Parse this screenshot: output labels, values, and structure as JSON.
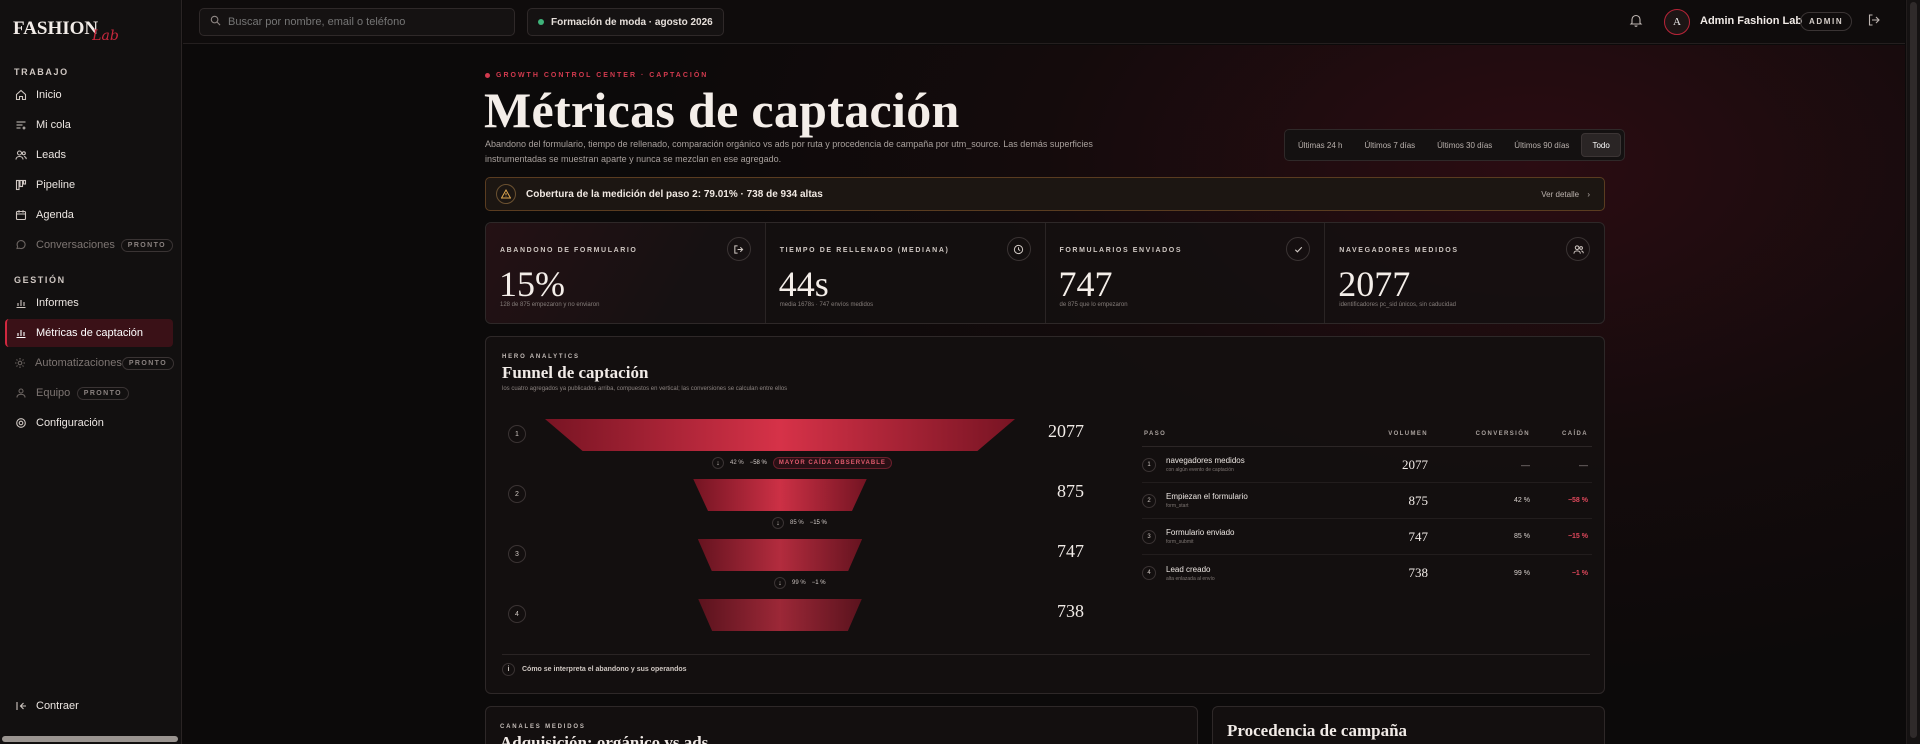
{
  "brand": {
    "logo_text": "FASHION",
    "logo_script": "Lab"
  },
  "sidebar": {
    "section_work": "TRABAJO",
    "section_manage": "GESTIÓN",
    "items": [
      {
        "label": "Inicio",
        "icon": "home-icon"
      },
      {
        "label": "Mi cola",
        "icon": "queue-icon"
      },
      {
        "label": "Leads",
        "icon": "users-icon"
      },
      {
        "label": "Pipeline",
        "icon": "pipeline-icon"
      },
      {
        "label": "Agenda",
        "icon": "calendar-icon"
      },
      {
        "label": "Conversaciones",
        "icon": "chat-icon",
        "badge": "PRONTO"
      },
      {
        "label": "Informes",
        "icon": "bar-chart-icon"
      },
      {
        "label": "Métricas de captación",
        "icon": "bar-chart-icon"
      },
      {
        "label": "Automatizaciones",
        "icon": "gear-icon",
        "badge": "PRONTO"
      },
      {
        "label": "Equipo",
        "icon": "team-icon",
        "badge": "PRONTO"
      },
      {
        "label": "Configuración",
        "icon": "settings-icon"
      }
    ],
    "collapse_label": "Contraer"
  },
  "topbar": {
    "search_placeholder": "Buscar por nombre, email o teléfono",
    "cohort": "Formación de moda · agosto 2026",
    "avatar_initial": "A",
    "user_name": "Admin Fashion Lab",
    "role_badge": "ADMIN"
  },
  "header": {
    "eyebrow": "GROWTH CONTROL CENTER · CAPTACIÓN",
    "title": "Métricas de captación",
    "description": "Abandono del formulario, tiempo de rellenado, comparación orgánico vs ads por ruta y procedencia de campaña por utm_source. Las demás superficies instrumentadas se muestran aparte y nunca se mezclan en ese agregado."
  },
  "ranges": [
    "Últimas 24 h",
    "Últimos 7 días",
    "Últimos 30 días",
    "Últimos 90 días",
    "Todo"
  ],
  "active_range": "Todo",
  "alert": {
    "message": "Cobertura de la medición del paso 2: 79.01% · 738 de 934 altas",
    "link": "Ver detalle"
  },
  "kpis": [
    {
      "label": "ABANDONO DE FORMULARIO",
      "value": "15%",
      "sub": "128 de 875 empezaron y no enviaron",
      "icon": "exit-icon"
    },
    {
      "label": "TIEMPO DE RELLENADO (MEDIANA)",
      "value": "44s",
      "sub": "media 1678s · 747 envíos medidos",
      "icon": "clock-icon"
    },
    {
      "label": "FORMULARIOS ENVIADOS",
      "value": "747",
      "sub": "de 875 que lo empezaron",
      "icon": "check-icon"
    },
    {
      "label": "NAVEGADORES MEDIDOS",
      "value": "2077",
      "sub": "identificadores pc_sid únicos, sin caducidad",
      "icon": "users-icon"
    }
  ],
  "funnel": {
    "eyebrow": "HERO ANALYTICS",
    "title": "Funnel de captación",
    "description": "los cuatro agregados ya publicados arriba, compuestos en vertical; las conversiones se calculan entre ellos",
    "steps": [
      {
        "n": "1",
        "value": "2077",
        "fraction": 1.0
      },
      {
        "n": "2",
        "value": "875",
        "fraction": 0.42
      },
      {
        "n": "3",
        "value": "747",
        "fraction": 0.36
      },
      {
        "n": "4",
        "value": "738",
        "fraction": 0.355
      }
    ],
    "drops": [
      {
        "conv": "42 %",
        "drop": "−58 %",
        "flag": "MAYOR CAÍDA OBSERVABLE"
      },
      {
        "conv": "85 %",
        "drop": "−15 %",
        "flag": ""
      },
      {
        "conv": "99 %",
        "drop": "−1 %",
        "flag": ""
      }
    ],
    "table_headers": [
      "PASO",
      "VOLUMEN",
      "CONVERSIÓN",
      "CAÍDA"
    ],
    "rows": [
      {
        "n": "1",
        "name": "navegadores medidos",
        "sub": "con algún evento de captación",
        "volume": "2077",
        "conv": "—",
        "drop": "—"
      },
      {
        "n": "2",
        "name": "Empiezan el formulario",
        "sub": "form_start",
        "volume": "875",
        "conv": "42 %",
        "drop": "−58 %"
      },
      {
        "n": "3",
        "name": "Formulario enviado",
        "sub": "form_submit",
        "volume": "747",
        "conv": "85 %",
        "drop": "−15 %"
      },
      {
        "n": "4",
        "name": "Lead creado",
        "sub": "alta enlazada al envío",
        "volume": "738",
        "conv": "99 %",
        "drop": "−1 %"
      }
    ],
    "footer": "Cómo se interpreta el abandono y sus operandos"
  },
  "bottom_cards": [
    {
      "eyebrow": "CANALES MEDIDOS",
      "title": "Adquisición: orgánico vs ads"
    },
    {
      "eyebrow": "",
      "title": "Procedencia de campaña"
    }
  ],
  "colors": {
    "accent": "#d0283f",
    "background": "#0c0a0a",
    "warning": "#e0a850"
  }
}
